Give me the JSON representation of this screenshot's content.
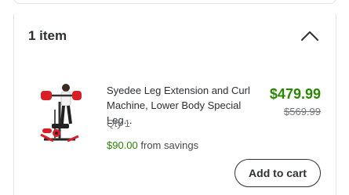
{
  "header": {
    "title": "1 item"
  },
  "icons": {
    "collapse": "chevron-up-icon"
  },
  "product": {
    "image_icon": "leg-extension-machine-image",
    "title": "Syedee Leg Extension and Curl Machine, Lower Body Special Leg...",
    "qty": "Qty 1",
    "price": "$479.99",
    "original_price": "$569.99",
    "savings_amount": "$90.00",
    "savings_suffix": " from savings"
  },
  "actions": {
    "add_to_cart": "Add to cart"
  },
  "colors": {
    "price_green": "#2a8703",
    "text_dark": "#2e2f32",
    "text_muted": "#74767c",
    "machine_red": "#d81e27",
    "border": "#e3e4e5"
  }
}
